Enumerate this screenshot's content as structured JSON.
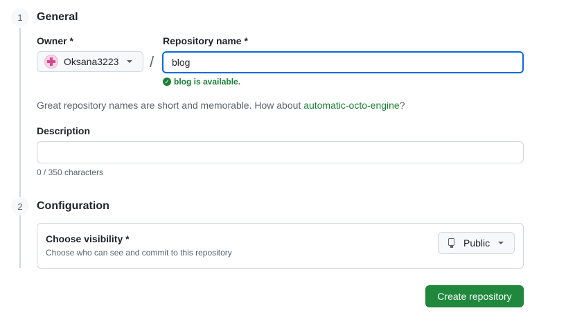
{
  "steps": [
    {
      "number": "1",
      "title": "General"
    },
    {
      "number": "2",
      "title": "Configuration"
    }
  ],
  "owner": {
    "label": "Owner *",
    "value": "Oksana3223"
  },
  "separator": "/",
  "repo_name": {
    "label": "Repository name *",
    "value": "blog"
  },
  "availability": {
    "text": "blog is available.",
    "color": "#1a7f37"
  },
  "suggestion": {
    "prefix": "Great repository names are short and memorable. How about ",
    "name": "automatic-octo-engine",
    "suffix": "?"
  },
  "description": {
    "label": "Description",
    "value": "",
    "counter": "0 / 350 characters"
  },
  "visibility": {
    "title": "Choose visibility *",
    "subtitle": "Choose who can see and commit to this repository",
    "value": "Public"
  },
  "create_button": "Create repository",
  "colors": {
    "accent": "#0969da",
    "success": "#1a7f37",
    "primary_button": "#1f883d"
  }
}
